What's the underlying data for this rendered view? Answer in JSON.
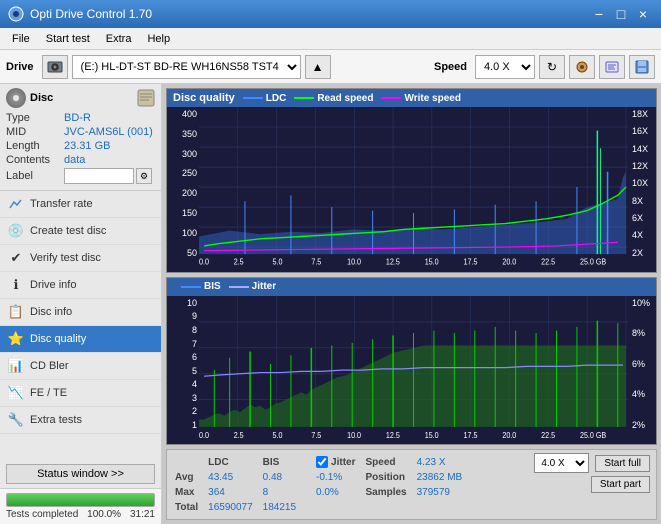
{
  "titlebar": {
    "title": "Opti Drive Control 1.70",
    "minimize": "−",
    "maximize": "□",
    "close": "×"
  },
  "menubar": {
    "items": [
      "File",
      "Start test",
      "Extra",
      "Help"
    ]
  },
  "toolbar": {
    "drive_label": "Drive",
    "drive_value": "(E:)  HL-DT-ST BD-RE  WH16NS58 TST4",
    "speed_label": "Speed",
    "speed_value": "4.0 X"
  },
  "disc": {
    "header": "Disc",
    "type_label": "Type",
    "type_value": "BD-R",
    "mid_label": "MID",
    "mid_value": "JVC-AMS6L (001)",
    "length_label": "Length",
    "length_value": "23.31 GB",
    "contents_label": "Contents",
    "contents_value": "data",
    "label_label": "Label",
    "label_value": ""
  },
  "nav_items": [
    {
      "id": "transfer-rate",
      "label": "Transfer rate",
      "icon": "📈"
    },
    {
      "id": "create-test-disc",
      "label": "Create test disc",
      "icon": "💿"
    },
    {
      "id": "verify-test-disc",
      "label": "Verify test disc",
      "icon": "✔"
    },
    {
      "id": "drive-info",
      "label": "Drive info",
      "icon": "ℹ"
    },
    {
      "id": "disc-info",
      "label": "Disc info",
      "icon": "📋"
    },
    {
      "id": "disc-quality",
      "label": "Disc quality",
      "icon": "⭐",
      "active": true
    },
    {
      "id": "cd-bler",
      "label": "CD Bler",
      "icon": "📊"
    },
    {
      "id": "fe-te",
      "label": "FE / TE",
      "icon": "📉"
    },
    {
      "id": "extra-tests",
      "label": "Extra tests",
      "icon": "🔧"
    }
  ],
  "status_window_btn": "Status window >>",
  "progress": {
    "value": 100,
    "label": "100.0%",
    "time": "31:21"
  },
  "disc_quality_chart": {
    "title": "Disc quality",
    "legend": [
      {
        "label": "LDC",
        "color": "#4444ff"
      },
      {
        "label": "Read speed",
        "color": "#00ff00"
      },
      {
        "label": "Write speed",
        "color": "#ff00ff"
      }
    ],
    "left_axis": [
      "400",
      "350",
      "300",
      "250",
      "200",
      "150",
      "100",
      "50"
    ],
    "right_axis": [
      "18X",
      "16X",
      "14X",
      "12X",
      "10X",
      "8X",
      "6X",
      "4X",
      "2X"
    ],
    "x_axis": [
      "0.0",
      "2.5",
      "5.0",
      "7.5",
      "10.0",
      "12.5",
      "15.0",
      "17.5",
      "20.0",
      "22.5",
      "25.0 GB"
    ]
  },
  "bis_chart": {
    "legend": [
      {
        "label": "BIS",
        "color": "#4444ff"
      },
      {
        "label": "Jitter",
        "color": "#aaaaff"
      }
    ],
    "left_axis": [
      "10",
      "9",
      "8",
      "7",
      "6",
      "5",
      "4",
      "3",
      "2",
      "1"
    ],
    "right_axis": [
      "10%",
      "8%",
      "6%",
      "4%",
      "2%"
    ],
    "x_axis": [
      "0.0",
      "2.5",
      "5.0",
      "7.5",
      "10.0",
      "12.5",
      "15.0",
      "17.5",
      "20.0",
      "22.5",
      "25.0 GB"
    ]
  },
  "stats": {
    "columns": [
      "",
      "LDC",
      "BIS",
      "",
      "Jitter",
      "Speed",
      ""
    ],
    "avg_label": "Avg",
    "avg_ldc": "43.45",
    "avg_bis": "0.48",
    "avg_jitter": "-0.1%",
    "max_label": "Max",
    "max_ldc": "364",
    "max_bis": "8",
    "max_jitter": "0.0%",
    "total_label": "Total",
    "total_ldc": "16590077",
    "total_bis": "184215",
    "speed_label": "Speed",
    "speed_value": "4.23 X",
    "position_label": "Position",
    "position_value": "23862 MB",
    "samples_label": "Samples",
    "samples_value": "379579",
    "speed_select": "4.0 X",
    "start_full_btn": "Start full",
    "start_part_btn": "Start part",
    "jitter_checked": true,
    "jitter_label": "Jitter"
  }
}
